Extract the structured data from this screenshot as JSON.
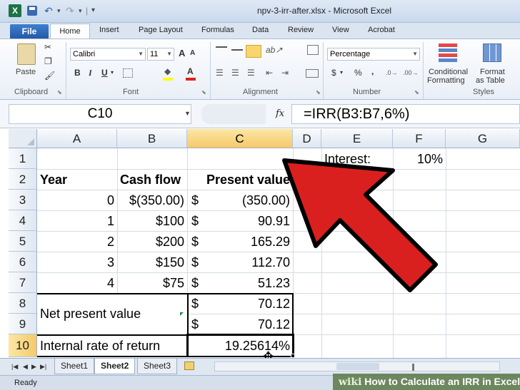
{
  "window": {
    "title": "npv-3-irr-after.xlsx - Microsoft Excel"
  },
  "qat": {
    "app_icon": "X"
  },
  "ribbon": {
    "file_tab": "File",
    "tabs": [
      "Home",
      "Insert",
      "Page Layout",
      "Formulas",
      "Data",
      "Review",
      "View",
      "Acrobat"
    ],
    "groups": [
      "Clipboard",
      "Font",
      "Alignment",
      "Number",
      "Styles"
    ],
    "clipboard": {
      "paste": "Paste"
    },
    "font": {
      "name": "Calibri",
      "size": "11",
      "grow": "A",
      "shrink": "A",
      "bold": "B",
      "italic": "I",
      "underline": "U"
    },
    "number": {
      "format": "Percentage",
      "currency": "$",
      "percent": "%",
      "comma": ","
    },
    "styles": {
      "conditional": [
        "Conditional",
        "Formatting"
      ],
      "format_table": [
        "Format",
        "as Table"
      ]
    }
  },
  "formula_bar": {
    "name_box": "C10",
    "fx": "fx",
    "formula": "=IRR(B3:B7,6%)"
  },
  "grid": {
    "columns": [
      "A",
      "B",
      "C",
      "D",
      "E",
      "F",
      "G"
    ],
    "rows": [
      "1",
      "2",
      "3",
      "4",
      "5",
      "6",
      "7",
      "8",
      "9",
      "10"
    ],
    "selected_cell": "C10",
    "header_labels": {
      "year": "Year",
      "cash_flow": "Cash flow",
      "present_value": "Present value"
    },
    "interest_label": "Interest:",
    "interest_value": "10%",
    "data_rows": [
      {
        "year": "0",
        "cash_flow": "$(350.00)",
        "pv_sym": "$",
        "pv": "(350.00)"
      },
      {
        "year": "1",
        "cash_flow": "$100",
        "pv_sym": "$",
        "pv": "90.91"
      },
      {
        "year": "2",
        "cash_flow": "$200",
        "pv_sym": "$",
        "pv": "165.29"
      },
      {
        "year": "3",
        "cash_flow": "$150",
        "pv_sym": "$",
        "pv": "112.70"
      },
      {
        "year": "4",
        "cash_flow": "$75",
        "pv_sym": "$",
        "pv": "51.23"
      }
    ],
    "npv_label": "Net present value",
    "npv_row8": {
      "sym": "$",
      "value": "70.12"
    },
    "npv_row9": {
      "sym": "$",
      "value": "70.12"
    },
    "irr_label": "Internal rate of return",
    "irr_value": "19.25614%"
  },
  "sheets": {
    "tabs": [
      "Sheet1",
      "Sheet2",
      "Sheet3"
    ],
    "active": "Sheet2"
  },
  "status": {
    "text": "Ready"
  },
  "watermark": {
    "brand": "wiki",
    "text": "How to Calculate an IRR in Excel"
  },
  "colors": {
    "arrow_fill": "#d9201f",
    "arrow_stroke": "#000000",
    "selection_header": "#f5c96a",
    "file_tab": "#2b63b1"
  }
}
